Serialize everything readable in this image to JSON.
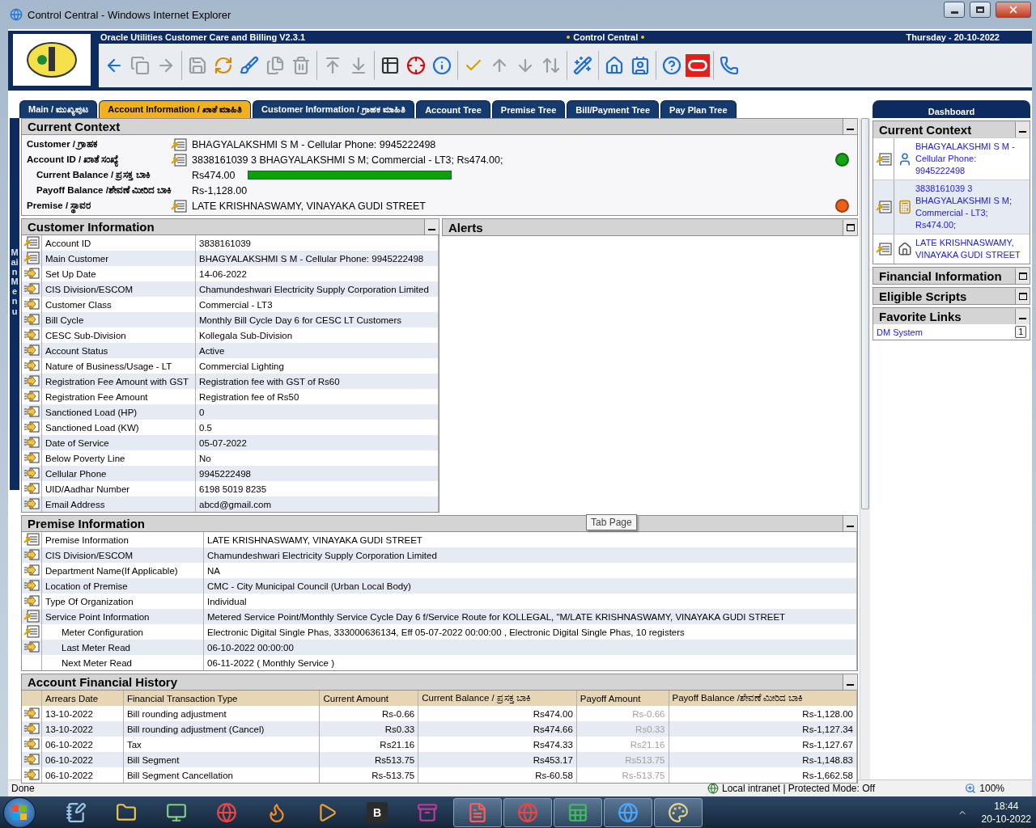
{
  "window": {
    "title": "Control Central - Windows Internet Explorer"
  },
  "app_header": {
    "product": "Oracle Utilities Customer Care and Billing V2.3.1",
    "portal": "Control Central",
    "date": "Thursday - 20-10-2022"
  },
  "toolbar": [
    {
      "kind": "back",
      "disabled": false
    },
    {
      "kind": "copy",
      "disabled": true
    },
    {
      "kind": "forward",
      "disabled": true
    },
    {
      "kind": "separator"
    },
    {
      "kind": "save",
      "disabled": true
    },
    {
      "kind": "refresh",
      "disabled": false
    },
    {
      "kind": "clear",
      "disabled": false
    },
    {
      "kind": "duplicate",
      "disabled": true
    },
    {
      "kind": "delete",
      "disabled": true
    },
    {
      "kind": "separator"
    },
    {
      "kind": "go-up",
      "disabled": true
    },
    {
      "kind": "go-down",
      "disabled": true
    },
    {
      "kind": "separator"
    },
    {
      "kind": "table",
      "disabled": false
    },
    {
      "kind": "target",
      "disabled": false
    },
    {
      "kind": "info",
      "disabled": false
    },
    {
      "kind": "separator"
    },
    {
      "kind": "check",
      "disabled": false
    },
    {
      "kind": "up",
      "disabled": true
    },
    {
      "kind": "down",
      "disabled": true
    },
    {
      "kind": "updown",
      "disabled": true
    },
    {
      "kind": "separator"
    },
    {
      "kind": "wand",
      "disabled": false
    },
    {
      "kind": "separator"
    },
    {
      "kind": "home",
      "disabled": false
    },
    {
      "kind": "user",
      "disabled": false
    },
    {
      "kind": "separator"
    },
    {
      "kind": "help",
      "disabled": false
    },
    {
      "kind": "oracle",
      "disabled": false
    },
    {
      "kind": "separator"
    },
    {
      "kind": "phone",
      "disabled": false
    }
  ],
  "tabs": [
    {
      "label": "Main / ಮುಖ್ಯಪುಟ",
      "selected": false
    },
    {
      "label": "Account Information / ಖಾತೆ ಮಾಹಿತಿ",
      "selected": true
    },
    {
      "label": "Customer Information / ಗ್ರಾಹಕ ಮಾಹಿತಿ",
      "selected": false
    },
    {
      "label": "Account Tree",
      "selected": false
    },
    {
      "label": "Premise Tree",
      "selected": false
    },
    {
      "label": "Bill/Payment Tree",
      "selected": false
    },
    {
      "label": "Pay Plan Tree",
      "selected": false
    }
  ],
  "main_menu": "Main Menu",
  "current_context": {
    "title": "Current Context",
    "expanded": true,
    "rows": [
      {
        "kind": "main",
        "label": "Customer / ಗ್ರಾಹಕ",
        "value": "BHAGYALAKSHMI S M - Cellular Phone: 9945222498"
      },
      {
        "kind": "main",
        "label": "Account ID / ಖಾತೆ ಸಂಖ್ಯೆ",
        "value": "3838161039 3 BHAGYALAKSHMI S M; Commercial - LT3; Rs474.00;",
        "color": "#16a316"
      },
      {
        "kind": "balance",
        "label": "Current Balance / ಪ್ರಸಕ್ತ ಬಾಕಿ",
        "value": "Rs474.00"
      },
      {
        "kind": "sub",
        "label": "Payoff Balance /ಶೇವಣೆ ಮೀರಿದ ಬಾಕಿ",
        "value": "Rs-1,128.00"
      },
      {
        "kind": "main",
        "label": "Premise / ಸ್ಥಾವರ",
        "value": "LATE KRISHNASWAMY, VINAYAKA GUDI STREET",
        "color": "#e8621a"
      }
    ]
  },
  "customer_information": {
    "title": "Customer Information",
    "expanded": true,
    "rows": [
      {
        "kind": "context",
        "label": "Account ID",
        "value": "3838161039"
      },
      {
        "kind": "context",
        "label": "Main Customer",
        "value": "BHAGYALAKSHMI S M - Cellular Phone: 9945222498"
      },
      {
        "kind": "drill",
        "label": "Set Up Date",
        "value": "14-06-2022"
      },
      {
        "kind": "drill",
        "label": "CIS Division/ESCOM",
        "value": "Chamundeshwari Electricity Supply Corporation Limited"
      },
      {
        "kind": "drill",
        "label": "Customer Class",
        "value": "Commercial - LT3"
      },
      {
        "kind": "drill",
        "label": "Bill Cycle",
        "value": "Monthly Bill Cycle Day 6 for CESC LT Customers"
      },
      {
        "kind": "drill",
        "label": "CESC Sub-Division",
        "value": "Kollegala Sub-Division"
      },
      {
        "kind": "drill",
        "label": "Account Status",
        "value": "Active"
      },
      {
        "kind": "drill",
        "label": "Nature of Business/Usage - LT",
        "value": "Commercial Lighting"
      },
      {
        "kind": "drill",
        "label": "Registration Fee Amount with GST",
        "value": "Registration fee with GST of Rs60"
      },
      {
        "kind": "drill",
        "label": "Registration Fee Amount",
        "value": "Registration fee of Rs50"
      },
      {
        "kind": "drill",
        "label": "Sanctioned Load (HP)",
        "value": "0"
      },
      {
        "kind": "drill",
        "label": "Sanctioned Load (KW)",
        "value": "0.5"
      },
      {
        "kind": "drill",
        "label": "Date of Service",
        "value": "05-07-2022"
      },
      {
        "kind": "drill",
        "label": "Below Poverty Line",
        "value": "No"
      },
      {
        "kind": "drill",
        "label": "Cellular Phone",
        "value": "9945222498"
      },
      {
        "kind": "drill",
        "label": "UID/Aadhar Number",
        "value": "6198 5019 8235"
      },
      {
        "kind": "drill",
        "label": "Email Address",
        "value": "abcd@gmail.com"
      }
    ]
  },
  "alerts": {
    "title": "Alerts",
    "expanded": false
  },
  "tooltip": "Tab Page",
  "premise_information": {
    "title": "Premise Information",
    "expanded": true,
    "rows": [
      {
        "kind": "context",
        "label": "Premise Information",
        "value": "LATE KRISHNASWAMY, VINAYAKA GUDI STREET"
      },
      {
        "kind": "drill",
        "label": "CIS Division/ESCOM",
        "value": "Chamundeshwari Electricity Supply Corporation Limited"
      },
      {
        "kind": "drill",
        "label": "Department Name(If Applicable)",
        "value": "NA"
      },
      {
        "kind": "drill",
        "label": "Location of Premise",
        "value": "CMC - City Municipal Council (Urban Local Body)"
      },
      {
        "kind": "drill",
        "label": "Type Of Organization",
        "value": "Individual"
      },
      {
        "kind": "context",
        "label": "Service Point Information",
        "value": "Metered Service Point/Monthly Service Cycle Day 6 f/Service Route for KOLLEGAL, \"M/LATE KRISHNASWAMY, VINAYAKA GUDI STREET",
        "children": [
          {
            "kind": "context",
            "label": "Meter Configuration",
            "value": "Electronic Digital Single Phas, 333000636134, Eff 05-07-2022 00:00:00 , Electronic Digital Single Phas, 10 registers"
          },
          {
            "kind": "drill",
            "label": "Last Meter Read",
            "value": "06-10-2022 00:00:00"
          },
          {
            "kind": "none",
            "label": "Next Meter Read",
            "value": "06-11-2022 ( Monthly Service )"
          }
        ]
      }
    ]
  },
  "account_financial_history": {
    "title": "Account Financial History",
    "expanded": true,
    "columns": [
      "Arrears Date",
      "Financial Transaction Type",
      "Current Amount",
      "Current Balance / ಪ್ರಸಕ್ತ ಬಾಕಿ",
      "Payoff Amount",
      "Payoff Balance /ಶೇವಣೆ ಮೀರಿದ ಬಾಕಿ"
    ],
    "rows": [
      {
        "cells": [
          "13-10-2022",
          "Bill rounding adjustment",
          "Rs-0.66",
          "Rs474.00",
          "Rs-0.66",
          "Rs-1,128.00"
        ]
      },
      {
        "cells": [
          "13-10-2022",
          "Bill rounding adjustment (Cancel)",
          "Rs0.33",
          "Rs474.66",
          "Rs0.33",
          "Rs-1,127.34"
        ]
      },
      {
        "cells": [
          "06-10-2022",
          "Tax",
          "Rs21.16",
          "Rs474.33",
          "Rs21.16",
          "Rs-1,127.67"
        ]
      },
      {
        "cells": [
          "06-10-2022",
          "Bill Segment",
          "Rs513.75",
          "Rs453.17",
          "Rs513.75",
          "Rs-1,148.83"
        ]
      },
      {
        "cells": [
          "06-10-2022",
          "Bill Segment Cancellation",
          "Rs-513.75",
          "Rs-60.58",
          "Rs-513.75",
          "Rs-1,662.58"
        ]
      }
    ]
  },
  "dashboard": {
    "title": "Dashboard",
    "sections": [
      {
        "kind": "context",
        "title": "Current Context",
        "expanded": true,
        "items": [
          {
            "kind": "person",
            "text": "BHAGYALAKSHMI S M - Cellular Phone: 9945222498"
          },
          {
            "kind": "account",
            "text": "3838161039 3 BHAGYALAKSHMI S M; Commercial - LT3; Rs474.00;"
          },
          {
            "kind": "premise",
            "text": "LATE KRISHNASWAMY, VINAYAKA GUDI STREET"
          }
        ]
      },
      {
        "kind": "plain",
        "title": "Financial Information",
        "expanded": false
      },
      {
        "kind": "plain",
        "title": "Eligible Scripts",
        "expanded": false
      },
      {
        "kind": "links",
        "title": "Favorite Links",
        "expanded": true,
        "links": [
          {
            "text": "DM System",
            "count": "1"
          }
        ]
      }
    ]
  },
  "status_bar": {
    "status": "Done",
    "zone": "Local intranet | Protected Mode: Off",
    "zoom": "100%"
  },
  "taskbar": {
    "apps": [
      {
        "kind": "notepad",
        "running": false
      },
      {
        "kind": "folder",
        "running": false
      },
      {
        "kind": "monitor",
        "running": false
      },
      {
        "kind": "browser",
        "running": false
      },
      {
        "kind": "fox",
        "running": false
      },
      {
        "kind": "player",
        "running": false
      },
      {
        "kind": "letter",
        "text": "B",
        "running": false
      },
      {
        "kind": "archive",
        "running": false
      },
      {
        "kind": "pdf",
        "running": true
      },
      {
        "kind": "browser",
        "running": true
      },
      {
        "kind": "sheet",
        "running": true
      },
      {
        "kind": "globe",
        "running": true
      },
      {
        "kind": "palette",
        "running": true
      }
    ],
    "time": "18:44",
    "date": "20-10-2022"
  }
}
